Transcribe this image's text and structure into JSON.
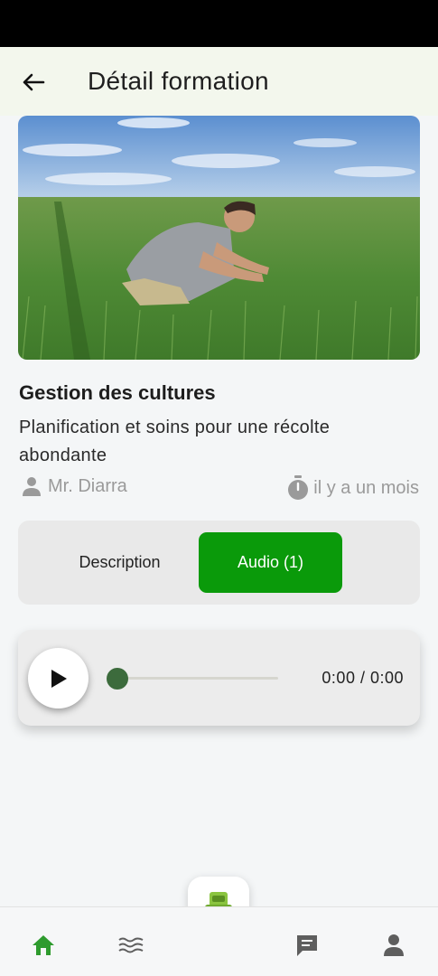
{
  "app_bar": {
    "title": "Détail formation",
    "back_icon": "arrow-left-icon"
  },
  "course": {
    "title": "Gestion des cultures",
    "subtitle": "Planification et soins pour une récolte abondante",
    "author": "Mr. Diarra",
    "posted": "il y a un mois",
    "image_alt": "Farmer inspecting a green wheat field"
  },
  "tabs": [
    {
      "label": "Description",
      "active": false
    },
    {
      "label": "Audio (1)",
      "active": true
    }
  ],
  "player": {
    "time": "0:00 / 0:00",
    "progress": 0,
    "play_icon": "play-icon"
  },
  "bottom_nav": {
    "items": [
      {
        "icon": "home-icon",
        "active": true
      },
      {
        "icon": "waves-icon",
        "active": false
      },
      {
        "icon": "robot-icon",
        "active": false
      },
      {
        "icon": "chat-icon",
        "active": false
      },
      {
        "icon": "person-icon",
        "active": false
      }
    ]
  },
  "colors": {
    "accent_green": "#0a9a0a",
    "player_green": "#3c6b3c",
    "nav_active": "#2e9b2e",
    "nav_inactive": "#5e5e5e",
    "meta_gray": "#9a9a9a"
  }
}
